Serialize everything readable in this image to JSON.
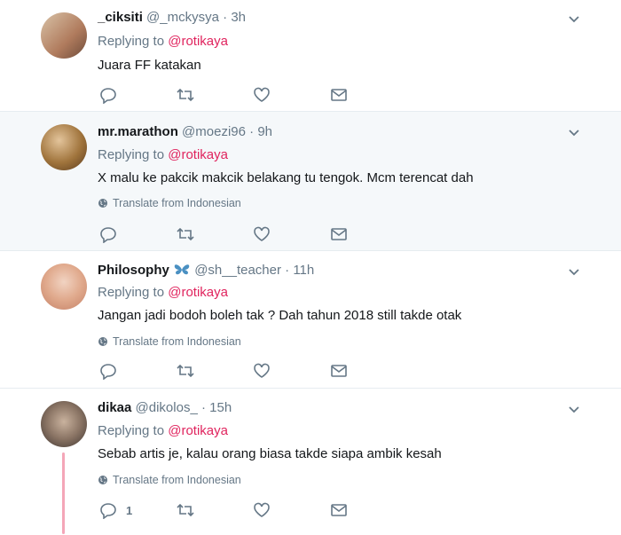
{
  "tweets": [
    {
      "name": "_ciksiti",
      "handle": "@_mckysya",
      "dot": "·",
      "time": "3h",
      "replying_prefix": "Replying to",
      "replying_to": "@rotikaya",
      "text": "Juara FF katakan",
      "translate": ""
    },
    {
      "name": "mr.marathon",
      "handle": "@moezi96",
      "dot": "·",
      "time": "9h",
      "replying_prefix": "Replying to",
      "replying_to": "@rotikaya",
      "text": "X malu ke pakcik makcik belakang tu tengok. Mcm terencat dah",
      "translate": "Translate from Indonesian"
    },
    {
      "name": "Philosophy",
      "name_emoji": "butterfly-icon",
      "handle": "@sh__teacher",
      "dot": "·",
      "time": "11h",
      "replying_prefix": "Replying to",
      "replying_to": "@rotikaya",
      "text": "Jangan jadi bodoh boleh tak ? Dah tahun 2018 still takde otak",
      "translate": "Translate from Indonesian"
    },
    {
      "name": "dikaa",
      "handle": "@dikolos_",
      "dot": "·",
      "time": "15h",
      "replying_prefix": "Replying to",
      "replying_to": "@rotikaya",
      "text": "Sebab artis je, kalau orang biasa takde siapa ambik kesah",
      "translate": "Translate from Indonesian",
      "reply_count": "1"
    }
  ],
  "colors": {
    "mention": "#e0245e",
    "secondary": "#657786",
    "highlight_bg": "#f5f8fa",
    "thread_line": "#f4a6b8",
    "butterfly": "#4a90c2"
  }
}
